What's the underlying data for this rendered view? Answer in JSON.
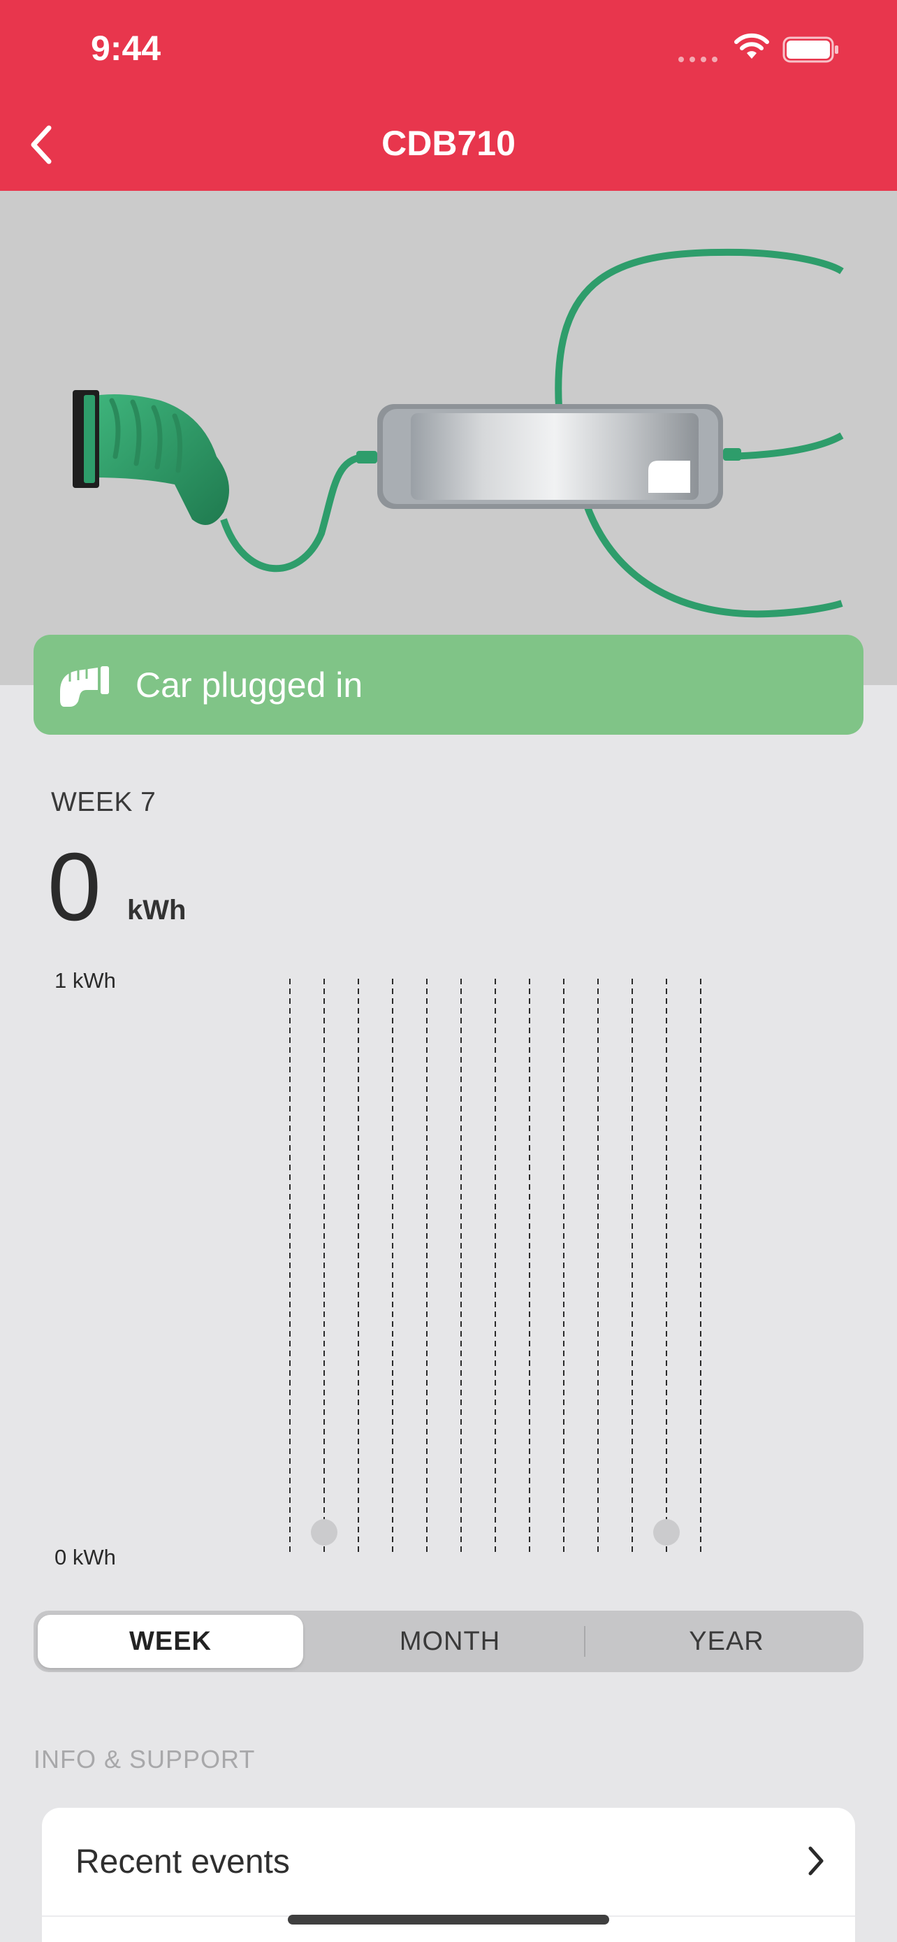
{
  "status_bar": {
    "time": "9:44"
  },
  "nav": {
    "title": "CDB710",
    "back_icon": "chevron-left-icon"
  },
  "charger_status": {
    "label": "Car plugged in",
    "icon": "plug-icon",
    "color": "#80c487"
  },
  "stats": {
    "period_label": "WEEK 7",
    "total_value": "0",
    "total_unit": "kWh"
  },
  "chart_data": {
    "type": "bar",
    "y_max_label": "1 kWh",
    "y_min_label": "0 kWh",
    "ylim": [
      0,
      1
    ],
    "categories": [
      "",
      "",
      "",
      "",
      "",
      "",
      "",
      "",
      "",
      "",
      "",
      "",
      ""
    ],
    "values": [
      0,
      0,
      0,
      0,
      0,
      0,
      0,
      0,
      0,
      0,
      0,
      0,
      0
    ],
    "markers": [
      1,
      11
    ],
    "grid": "vertical-dashed"
  },
  "segmented": {
    "week": "WEEK",
    "month": "MONTH",
    "year": "YEAR",
    "selected": "WEEK"
  },
  "info_support": {
    "header": "INFO & SUPPORT",
    "items": [
      {
        "label": "Recent events"
      }
    ]
  },
  "colors": {
    "header": "#e8364d",
    "accent_green": "#2e9d6b"
  }
}
